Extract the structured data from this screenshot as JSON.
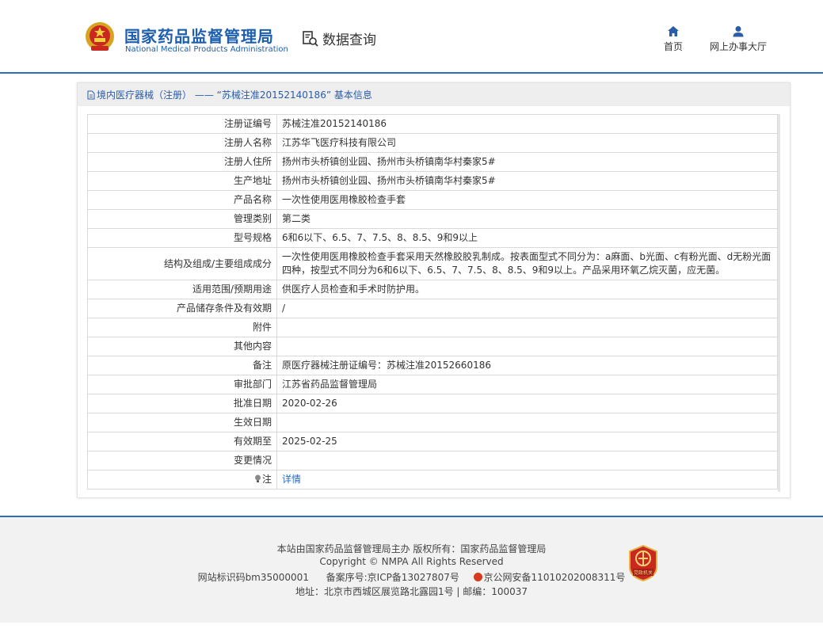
{
  "header": {
    "brand_cn": "国家药品监督管理局",
    "brand_en": "National Medical Products Administration",
    "query_label": "数据查询",
    "nav": {
      "home": "首页",
      "hall": "网上办事大厅"
    }
  },
  "panel": {
    "title": "境内医疗器械（注册） —— “苏械注准20152140186” 基本信息"
  },
  "rows": [
    {
      "label": "注册证编号",
      "value": "苏械注准20152140186"
    },
    {
      "label": "注册人名称",
      "value": "江苏华飞医疗科技有限公司"
    },
    {
      "label": "注册人住所",
      "value": "扬州市头桥镇创业园、扬州市头桥镇南华村秦家5#"
    },
    {
      "label": "生产地址",
      "value": "扬州市头桥镇创业园、扬州市头桥镇南华村秦家5#"
    },
    {
      "label": "产品名称",
      "value": "一次性使用医用橡胶检查手套"
    },
    {
      "label": "管理类别",
      "value": "第二类"
    },
    {
      "label": "型号规格",
      "value": "6和6以下、6.5、7、7.5、8、8.5、9和9以上"
    },
    {
      "label": "结构及组成/主要组成成分",
      "value": "一次性使用医用橡胶检查手套采用天然橡胶胶乳制成。按表面型式不同分为：a麻面、b光面、c有粉光面、d无粉光面四种，按型式不同分为6和6以下、6.5、7、7.5、8、8.5、9和9以上。产品采用环氧乙烷灭菌，应无菌。"
    },
    {
      "label": "适用范围/预期用途",
      "value": "供医疗人员检查和手术时防护用。"
    },
    {
      "label": "产品储存条件及有效期",
      "value": "/"
    },
    {
      "label": "附件",
      "value": ""
    },
    {
      "label": "其他内容",
      "value": ""
    },
    {
      "label": "备注",
      "value": "原医疗器械注册证编号：苏械注准20152660186"
    },
    {
      "label": "审批部门",
      "value": "江苏省药品监督管理局"
    },
    {
      "label": "批准日期",
      "value": "2020-02-26"
    },
    {
      "label": "生效日期",
      "value": ""
    },
    {
      "label": "有效期至",
      "value": "2025-02-25"
    },
    {
      "label": "变更情况",
      "value": ""
    },
    {
      "label": "注",
      "value": "详情"
    }
  ],
  "footer": {
    "line1": "本站由国家药品监督管理局主办 版权所有：国家药品监督管理局",
    "line2": "Copyright © NMPA All Rights Reserved",
    "site_id": "网站标识码bm35000001",
    "icp": "备案序号:京ICP备13027807号",
    "police": "京公网安备11010202008311号",
    "line4": "地址：北京市西城区展览路北露园1号 | 邮编：100037",
    "badge_text": "党政机关"
  },
  "colors": {
    "brand_blue": "#1d5fae",
    "link_blue": "#2a6ab8",
    "rule_blue": "#2e6db4"
  }
}
